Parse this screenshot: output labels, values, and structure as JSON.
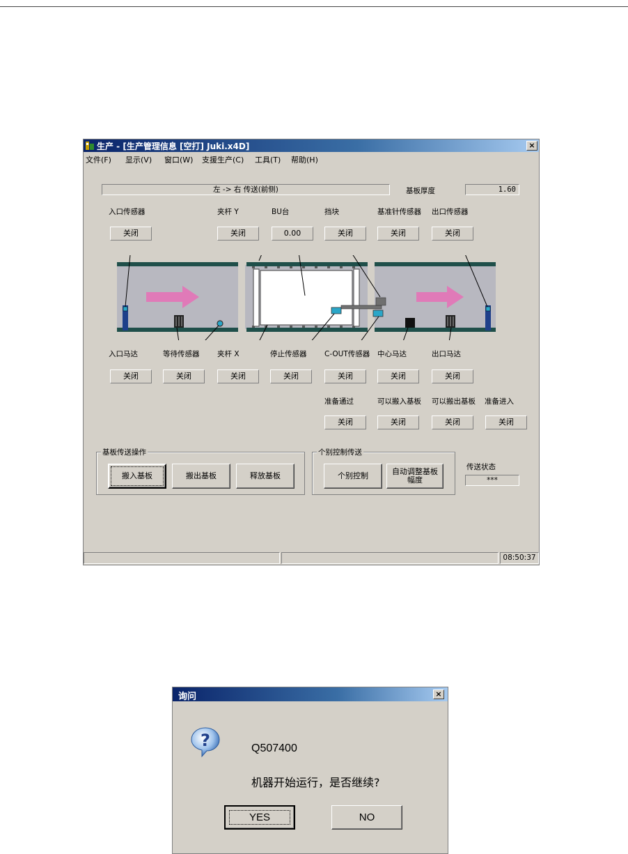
{
  "main_window": {
    "title": "生产 - [生产管理信息 [空打] Juki.x4D]",
    "close": "×",
    "menu": [
      "文件(F)",
      "显示(V)",
      "窗口(W)",
      "支援生产(C)",
      "工具(T)",
      "帮助(H)"
    ],
    "direction": "左 -> 右 传送(前侧)",
    "thickness_label": "基板厚度",
    "thickness_value": "1.60",
    "top_sensors": [
      {
        "label": "入口传感器",
        "state": "关闭"
      },
      {
        "label": "夹杆 Y",
        "state": "关闭"
      },
      {
        "label": "BU台",
        "state": "0.00"
      },
      {
        "label": "挡块",
        "state": "关闭"
      },
      {
        "label": "基准针传感器",
        "state": "关闭"
      },
      {
        "label": "出口传感器",
        "state": "关闭"
      }
    ],
    "bottom_sensors": [
      {
        "label": "入口马达",
        "state": "关闭"
      },
      {
        "label": "等待传感器",
        "state": "关闭"
      },
      {
        "label": "夹杆 X",
        "state": "关闭"
      },
      {
        "label": "停止传感器",
        "state": "关闭"
      },
      {
        "label": "C-OUT传感器",
        "state": "关闭"
      },
      {
        "label": "中心马达",
        "state": "关闭"
      },
      {
        "label": "出口马达",
        "state": "关闭"
      }
    ],
    "signals": [
      {
        "label": "准备通过",
        "state": "关闭"
      },
      {
        "label": "可以搬入基板",
        "state": "关闭"
      },
      {
        "label": "可以搬出基板",
        "state": "关闭"
      },
      {
        "label": "准备进入",
        "state": "关闭"
      }
    ],
    "group_transfer": {
      "title": "基板传送操作",
      "buttons": [
        "搬入基板",
        "搬出基板",
        "释放基板"
      ]
    },
    "group_individual": {
      "title": "个别控制传送",
      "buttons": [
        "个别控制",
        "自动调整基板幅度"
      ]
    },
    "transfer_state_label": "传送状态",
    "transfer_state_value": "***",
    "clock": "08:50:37",
    "colors": {
      "titlebar": "#0a246a",
      "arrow": "#e07ab8",
      "rail": "#1f4f4a",
      "sensor": "#2aa6c8"
    }
  },
  "dialog": {
    "title": "询问",
    "close": "×",
    "icon": "question-icon",
    "code": "Q507400",
    "message": "机器开始运行，是否继续?",
    "yes": "YES",
    "no": "NO"
  }
}
